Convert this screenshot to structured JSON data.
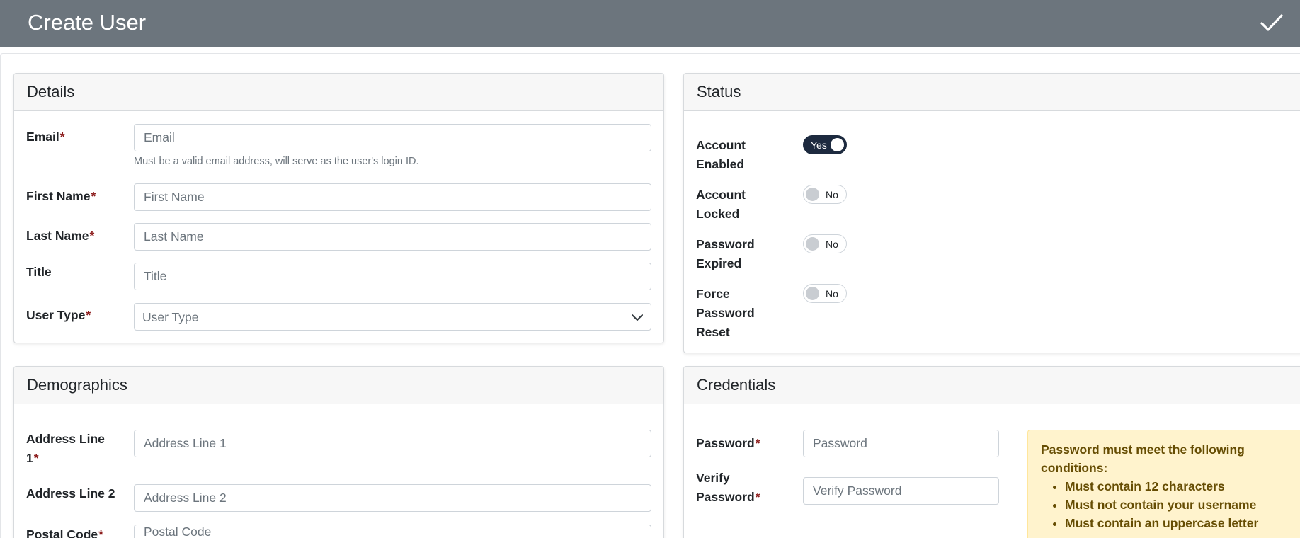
{
  "header": {
    "title": "Create User"
  },
  "details": {
    "title": "Details",
    "email": {
      "label": "Email",
      "placeholder": "Email",
      "help": "Must be a valid email address, will serve as the user's login ID."
    },
    "first_name": {
      "label": "First Name",
      "placeholder": "First Name"
    },
    "last_name": {
      "label": "Last Name",
      "placeholder": "Last Name"
    },
    "title_field": {
      "label": "Title",
      "placeholder": "Title"
    },
    "user_type": {
      "label": "User Type",
      "placeholder": "User Type"
    }
  },
  "status": {
    "title": "Status",
    "account_enabled": {
      "label_line1": "Account",
      "label_line2": "Enabled",
      "value": "Yes",
      "on": true
    },
    "account_locked": {
      "label_line1": "Account",
      "label_line2": "Locked",
      "value": "No",
      "on": false
    },
    "password_expired": {
      "label_line1": "Password",
      "label_line2": "Expired",
      "value": "No",
      "on": false
    },
    "force_reset": {
      "label_line1": "Force",
      "label_line2": "Password",
      "label_line3": "Reset",
      "value": "No",
      "on": false
    }
  },
  "demographics": {
    "title": "Demographics",
    "address1": {
      "label_line1": "Address Line",
      "label_line2": "1",
      "placeholder": "Address Line 1"
    },
    "address2": {
      "label": "Address Line 2",
      "placeholder": "Address Line 2"
    },
    "postal_code": {
      "label": "Postal Code",
      "placeholder": "Postal Code"
    }
  },
  "credentials": {
    "title": "Credentials",
    "password": {
      "label": "Password",
      "placeholder": "Password"
    },
    "verify": {
      "label_line1": "Verify",
      "label_line2": "Password",
      "placeholder": "Verify Password"
    },
    "rules": {
      "heading": "Password must meet the following conditions:",
      "items": [
        "Must contain 12 characters",
        "Must not contain your username",
        "Must contain an uppercase letter"
      ]
    }
  },
  "required_marker": "*",
  "icons": {
    "submit": "check-icon",
    "select": "chevron-down-icon"
  },
  "colors": {
    "header_bg": "#6c757d",
    "toggle_on": "#1d2a3f",
    "required": "#8b1a1a",
    "alert_bg": "#fff3cd",
    "alert_text": "#664d03"
  }
}
